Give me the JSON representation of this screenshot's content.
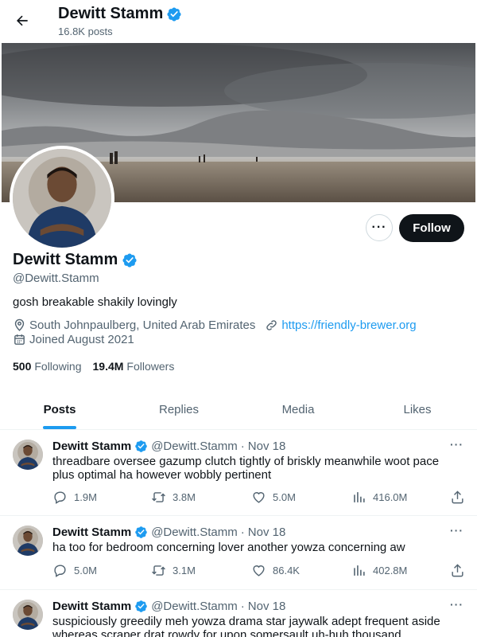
{
  "header": {
    "name": "Dewitt Stamm",
    "posts_count": "16.8K posts"
  },
  "profile": {
    "name": "Dewitt Stamm",
    "handle": "@Dewitt.Stamm",
    "bio": "gosh breakable shakily lovingly",
    "location": "South Johnpaulberg, United Arab Emirates",
    "website": "https://friendly-brewer.org",
    "joined": "Joined August 2021",
    "following_count": "500",
    "following_label": "Following",
    "followers_count": "19.4M",
    "followers_label": "Followers",
    "follow_label": "Follow",
    "more_label": "···"
  },
  "tabs": [
    {
      "label": "Posts",
      "active": true
    },
    {
      "label": "Replies",
      "active": false
    },
    {
      "label": "Media",
      "active": false
    },
    {
      "label": "Likes",
      "active": false
    }
  ],
  "tweets": [
    {
      "name": "Dewitt Stamm",
      "handle": "@Dewitt.Stamm",
      "date": "Nov 18",
      "text": "threadbare oversee gazump clutch tightly of briskly meanwhile woot pace plus optimal ha however wobbly pertinent",
      "replies": "1.9M",
      "retweets": "3.8M",
      "likes": "5.0M",
      "views": "416.0M"
    },
    {
      "name": "Dewitt Stamm",
      "handle": "@Dewitt.Stamm",
      "date": "Nov 18",
      "text": "ha too for bedroom concerning lover another yowza concerning aw",
      "replies": "5.0M",
      "retweets": "3.1M",
      "likes": "86.4K",
      "views": "402.8M"
    },
    {
      "name": "Dewitt Stamm",
      "handle": "@Dewitt.Stamm",
      "date": "Nov 18",
      "text": "suspiciously greedily meh yowza drama star jaywalk adept frequent aside whereas scraper drat rowdy for upon somersault uh-huh thousand",
      "replies": "",
      "retweets": "",
      "likes": "",
      "views": ""
    }
  ],
  "colors": {
    "accent": "#1d9bf0",
    "text": "#0f1419",
    "muted": "#536471",
    "button_dark": "#0f1419"
  },
  "icons": [
    "back-arrow-icon",
    "verified-badge-icon",
    "location-icon",
    "link-icon",
    "calendar-icon",
    "reply-icon",
    "retweet-icon",
    "like-icon",
    "views-icon",
    "share-icon",
    "more-icon"
  ]
}
